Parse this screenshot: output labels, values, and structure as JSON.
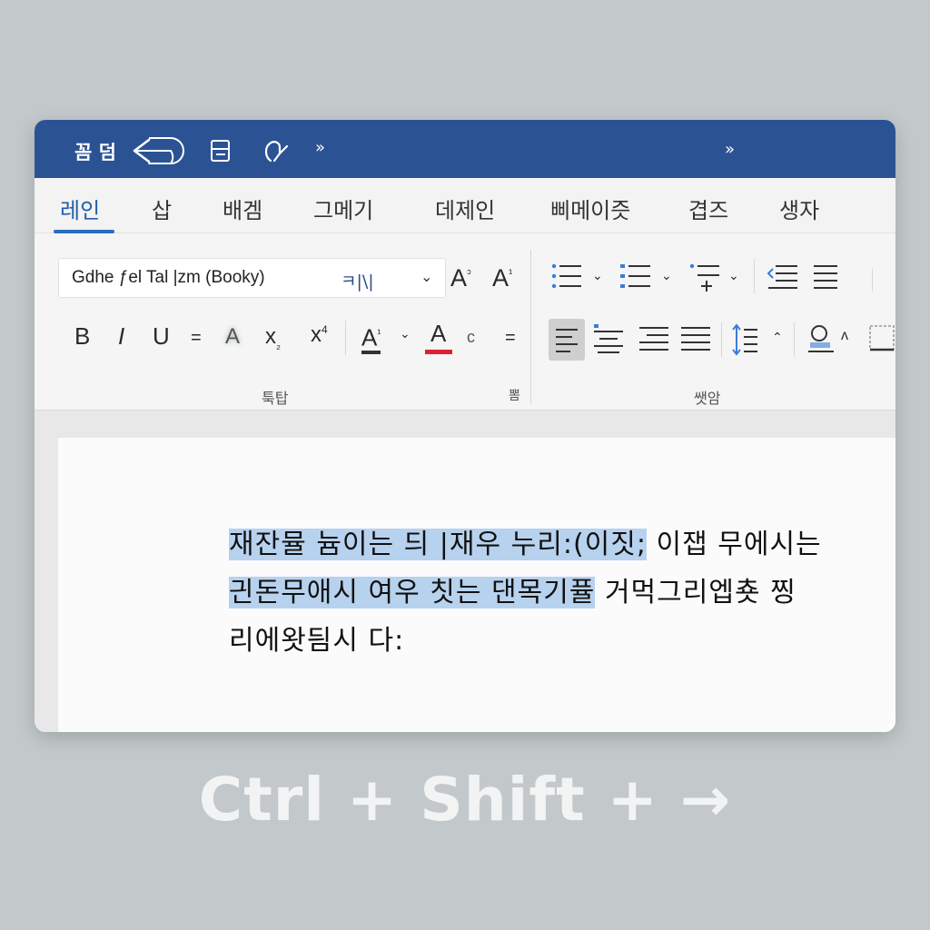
{
  "titlebar": {
    "qat_label": "꼼 덤",
    "more_left": "»",
    "more_right": "»",
    "color": "#2b5393"
  },
  "tabs": [
    {
      "label": "레인",
      "active": true
    },
    {
      "label": "삽"
    },
    {
      "label": "배겜"
    },
    {
      "label": "그메기"
    },
    {
      "label": "데제인"
    },
    {
      "label": "삐메이즛"
    },
    {
      "label": "겹즈"
    },
    {
      "label": "생자"
    }
  ],
  "ribbon": {
    "font_name": "Gdhe ƒel Tal |zm (Booky)",
    "font_size": "ㅋ|\\|",
    "grow_label": "A",
    "grow_sup": "ᵓ",
    "shrink_label": "A",
    "shrink_sup": "¹",
    "bold": "B",
    "italic": "I",
    "underline": "U",
    "strike": "=",
    "highlight_clear": "A",
    "subscript": "x",
    "subscript_sub": "₂",
    "superscript": "x",
    "superscript_sup": "4",
    "font_color": "A",
    "font_color_sup": "¹",
    "text_color": "A",
    "text_color_bar": "#e0202e",
    "extra_c": "c",
    "extra_eq": "=",
    "caret": "⌄",
    "group_font": "툭탑",
    "group_font_corner": "뽐",
    "group_paragraph": "쌧암",
    "more_small": "⌃",
    "para_fold": "⌃"
  },
  "document": {
    "line1_selected": "재잔뮬 늄이는 듸 |재우 누리:(이짓;",
    "line1_rest": " 이잽 무에시는",
    "line2_selected": "긘돈무애시 여우 칫는 댄목기퓰",
    "line2_rest": " 거먹그리엡춋 찡",
    "line3": "리에왓딈시 다:",
    "selection_color": "#b7d2ee"
  },
  "shortcut_hint": "Ctrl + Shift + →"
}
